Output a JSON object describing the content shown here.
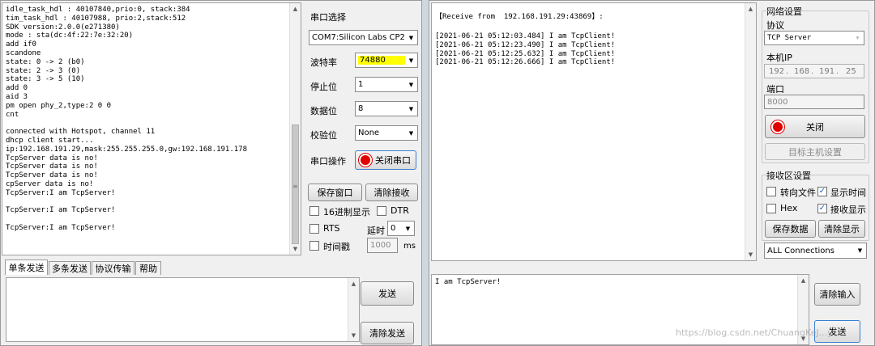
{
  "left_window": {
    "receive_lines": [
      "idle_task_hdl : 40107840,prio:0, stack:384",
      "tim_task_hdl : 40107988, prio:2,stack:512",
      "SDK version:2.0.0(e271380)",
      "mode : sta(dc:4f:22:7e:32:20)",
      "add if0",
      "scandone",
      "state: 0 -> 2 (b0)",
      "state: 2 -> 3 (0)",
      "state: 3 -> 5 (10)",
      "add 0",
      "aid 3",
      "pm open phy_2,type:2 0 0",
      "cnt",
      "",
      "connected with Hotspot, channel 11",
      "dhcp client start...",
      "ip:192.168.191.29,mask:255.255.255.0,gw:192.168.191.178",
      "TcpServer data is no!",
      "TcpServer data is no!",
      "TcpServer data is no!",
      "cpServer data is no!",
      "TcpServer:I am TcpServer!",
      "",
      "TcpServer:I am TcpServer!",
      "",
      "TcpServer:I am TcpServer!"
    ],
    "serial_select_label": "串口选择",
    "port_value": "COM7:Silicon Labs CP210",
    "baud_label": "波特率",
    "baud_value": "74880",
    "stop_label": "停止位",
    "stop_value": "1",
    "data_label": "数据位",
    "data_value": "8",
    "parity_label": "校验位",
    "parity_value": "None",
    "port_op_label": "串口操作",
    "close_port_btn": "关闭串口",
    "save_window_btn": "保存窗口",
    "clear_recv_btn": "清除接收",
    "hex_display_label": "16进制显示",
    "dtr_label": "DTR",
    "rts_label": "RTS",
    "delay_label": "延时",
    "delay_value": "0",
    "timestamp_label": "时间戳",
    "timestamp_value": "1000",
    "ms_label": "ms",
    "tabs": [
      "单条发送",
      "多条发送",
      "协议传输",
      "帮助"
    ],
    "send_btn": "发送",
    "clear_send_btn": "清除发送"
  },
  "right_window": {
    "receive_header": "【Receive from  192.168.191.29:43869】:",
    "receive_lines": [
      "[2021-06-21 05:12:03.484] I am TcpClient!",
      "[2021-06-21 05:12:23.490] I am TcpClient!",
      "[2021-06-21 05:12:25.632] I am TcpClient!",
      "[2021-06-21 05:12:26.666] I am TcpClient!"
    ],
    "net_settings_title": "网络设置",
    "protocol_label": "协议",
    "protocol_value": "TCP Server",
    "local_ip_label": "本机IP",
    "ip_parts": [
      "192",
      "168",
      "191",
      "25"
    ],
    "port_label": "端口",
    "port_value": "8000",
    "close_btn": "关闭",
    "target_host_btn": "目标主机设置",
    "recv_settings_title": "接收区设置",
    "to_file_label": "转向文件",
    "show_time_label": "显示时间",
    "hex_label": "Hex",
    "recv_show_label": "接收显示",
    "save_data_btn": "保存数据",
    "clear_show_btn": "清除显示",
    "connections_value": "ALL Connections",
    "send_text": "I am TcpServer!",
    "clear_input_btn": "清除输入",
    "send_btn": "发送",
    "watermark": "https://blog.csdn.net/ChuangKeJ...y"
  },
  "colors": {
    "baud_highlight": "#ffff00",
    "indicator_red": "#e00000",
    "check_blue": "#2060c0"
  }
}
